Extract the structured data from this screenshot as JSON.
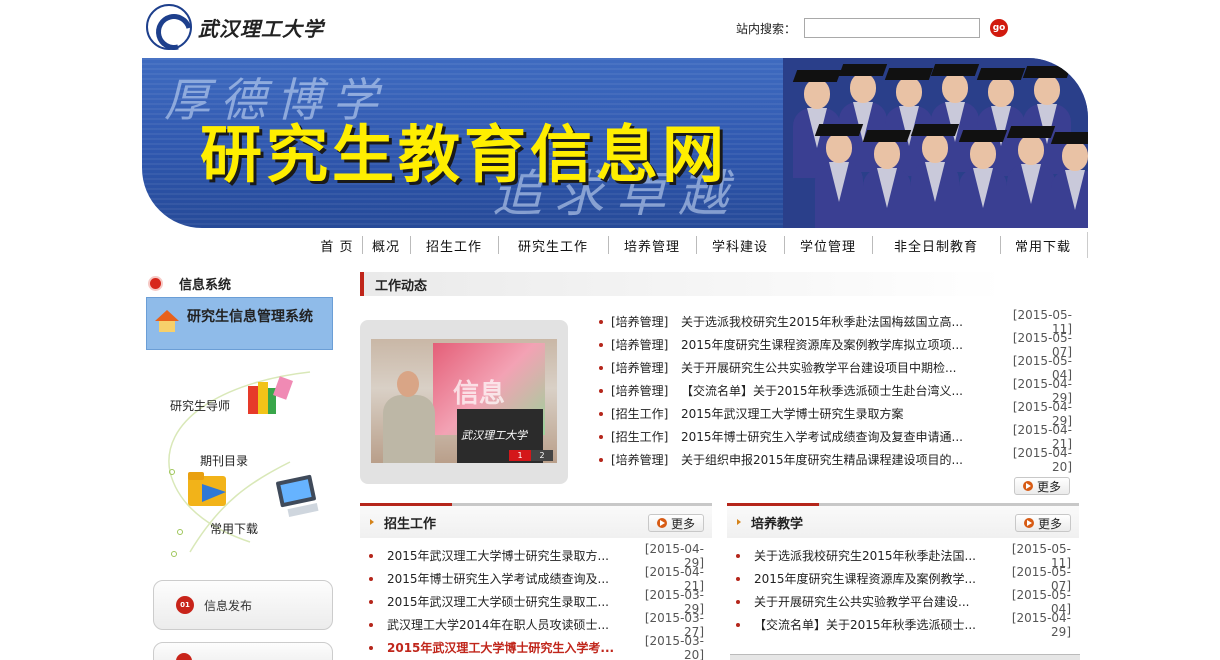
{
  "header": {
    "logo_text": "武汉理工大学",
    "search_label": "站内搜索：",
    "search_value": "",
    "go_label": "go"
  },
  "banner": {
    "title": "研究生教育信息网",
    "motto_line1": "厚德博学",
    "motto_line2": "追求卓越"
  },
  "nav": {
    "items": [
      "首 页",
      "概况",
      "招生工作",
      "研究生工作",
      "培养管理",
      "学科建设",
      "学位管理",
      "非全日制教育",
      "常用下载"
    ]
  },
  "sidebar": {
    "heading": "信息系统",
    "system_link": "研究生信息管理系统",
    "links": [
      "研究生导师",
      "期刊目录",
      "常用下载"
    ],
    "info_button": "信息发布",
    "info_badge": "01"
  },
  "news": {
    "heading": "工作动态",
    "more_label": "更多",
    "photo_podium_text": "武汉理工大学",
    "photo_screen_text": "信息",
    "slide_numbers": [
      "1",
      "2"
    ],
    "items": [
      {
        "category": "[培养管理]",
        "title": "关于选派我校研究生2015年秋季赴法国梅兹国立高...",
        "date": "[2015-05-11]"
      },
      {
        "category": "[培养管理]",
        "title": "2015年度研究生课程资源库及案例教学库拟立项项...",
        "date": "[2015-05-07]"
      },
      {
        "category": "[培养管理]",
        "title": "关于开展研究生公共实验教学平台建设项目中期检...",
        "date": "[2015-05-04]"
      },
      {
        "category": "[培养管理]",
        "title": "【交流名单】关于2015年秋季选派硕士生赴台湾义...",
        "date": "[2015-04-29]"
      },
      {
        "category": "[招生工作]",
        "title": "2015年武汉理工大学博士研究生录取方案",
        "date": "[2015-04-29]"
      },
      {
        "category": "[招生工作]",
        "title": "2015年博士研究生入学考试成绩查询及复查申请通...",
        "date": "[2015-04-21]"
      },
      {
        "category": "[培养管理]",
        "title": "关于组织申报2015年度研究生精品课程建设项目的...",
        "date": "[2015-04-20]"
      }
    ]
  },
  "admissions": {
    "heading": "招生工作",
    "more_label": "更多",
    "items": [
      {
        "title": "2015年武汉理工大学博士研究生录取方...",
        "date": "[2015-04-29]"
      },
      {
        "title": "2015年博士研究生入学考试成绩查询及...",
        "date": "[2015-04-21]"
      },
      {
        "title": "2015年武汉理工大学硕士研究生录取工...",
        "date": "[2015-03-29]"
      },
      {
        "title": "武汉理工大学2014年在职人员攻读硕士...",
        "date": "[2015-03-27]"
      },
      {
        "title": "2015年武汉理工大学博士研究生入学考...",
        "date": "[2015-03-20]"
      }
    ]
  },
  "teaching": {
    "heading": "培养教学",
    "more_label": "更多",
    "items": [
      {
        "title": "关于选派我校研究生2015年秋季赴法国...",
        "date": "[2015-05-11]"
      },
      {
        "title": "2015年度研究生课程资源库及案例教学...",
        "date": "[2015-05-07]"
      },
      {
        "title": "关于开展研究生公共实验教学平台建设...",
        "date": "[2015-05-04]"
      },
      {
        "title": "【交流名单】关于2015年秋季选派硕士...",
        "date": "[2015-04-29]"
      }
    ]
  },
  "colors": {
    "accent_red": "#c0261b",
    "banner_blue": "#2f57ae",
    "title_yellow": "#ffee00",
    "side_box_blue": "#8fbbe9"
  }
}
